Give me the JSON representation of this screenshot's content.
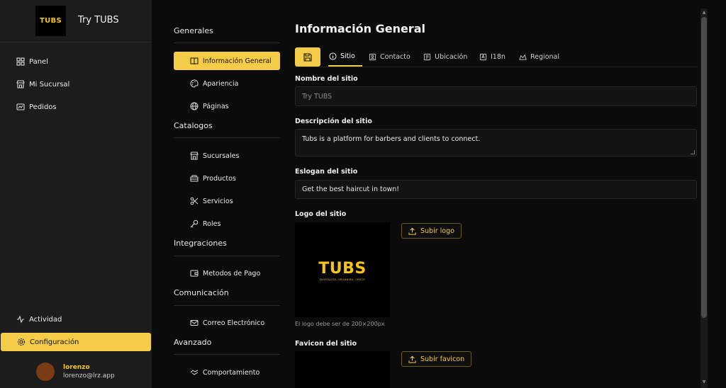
{
  "brand": {
    "logo_text": "TUBS",
    "title": "Try TUBS"
  },
  "sidebar": {
    "top_items": [
      {
        "label": "Panel",
        "icon": "dashboard-icon"
      },
      {
        "label": "Mi Sucursal",
        "icon": "store-icon"
      },
      {
        "label": "Pedidos",
        "icon": "orders-icon"
      }
    ],
    "bottom_items": [
      {
        "label": "Actividad",
        "icon": "activity-icon"
      },
      {
        "label": "Configuración",
        "icon": "gear-icon",
        "active": true
      }
    ]
  },
  "user": {
    "name": "lorenzo",
    "email": "lorenzo@lrz.app",
    "avatar_color": "#7a3d16"
  },
  "settings_nav": {
    "sections": [
      {
        "title": "Generales",
        "items": [
          {
            "label": "Información General",
            "icon": "book-icon",
            "active": true
          },
          {
            "label": "Apariencia",
            "icon": "palette-icon"
          },
          {
            "label": "Páginas",
            "icon": "globe-icon"
          }
        ]
      },
      {
        "title": "Catalogos",
        "items": [
          {
            "label": "Sucursales",
            "icon": "store-icon"
          },
          {
            "label": "Productos",
            "icon": "box-icon"
          },
          {
            "label": "Servicios",
            "icon": "scissors-icon"
          },
          {
            "label": "Roles",
            "icon": "key-icon"
          }
        ]
      },
      {
        "title": "Integraciones",
        "items": [
          {
            "label": "Metodos de Pago",
            "icon": "wallet-icon"
          }
        ]
      },
      {
        "title": "Comunicación",
        "items": [
          {
            "label": "Correo Electrónico",
            "icon": "mail-icon"
          }
        ]
      },
      {
        "title": "Avanzado",
        "items": [
          {
            "label": "Comportamiento",
            "icon": "handshake-icon"
          }
        ]
      }
    ]
  },
  "main": {
    "title": "Información General",
    "tabs": [
      {
        "label": "Sitio",
        "icon": "info-icon",
        "active": true
      },
      {
        "label": "Contacto",
        "icon": "contact-icon"
      },
      {
        "label": "Ubicación",
        "icon": "location-icon"
      },
      {
        "label": "I18n",
        "icon": "translate-icon"
      },
      {
        "label": "Regional",
        "icon": "region-icon"
      }
    ],
    "site_name": {
      "label": "Nombre del sitio",
      "placeholder": "Try TUBS"
    },
    "site_description": {
      "label": "Descripción del sitio",
      "value": "Tubs is a platform for barbers and clients to connect."
    },
    "site_slogan": {
      "label": "Eslogan del sitio",
      "value": "Get the best haircut in town!"
    },
    "logo": {
      "label": "Logo del sitio",
      "image_text": "TUBS",
      "image_tagline": "DIGITALIZA. ORGANIZA. CRECE",
      "upload_label": "Subir logo",
      "hint": "El logo debe ser de 200×200px"
    },
    "favicon": {
      "label": "Favicon del sitio",
      "upload_label": "Subir favicon"
    }
  },
  "colors": {
    "accent": "#f5cc47",
    "sidebar_bg": "#1c1c1c",
    "main_bg": "#0b0b0b"
  }
}
